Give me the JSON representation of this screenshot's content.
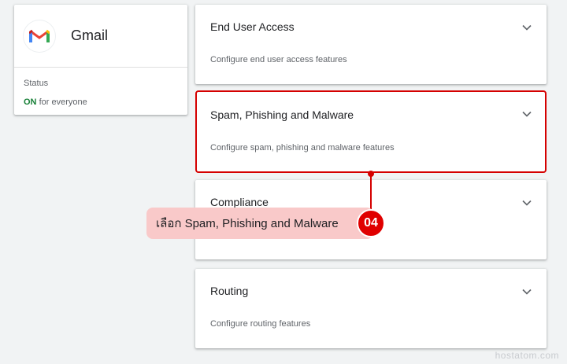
{
  "app": {
    "name": "Gmail",
    "status_label": "Status",
    "status_on": "ON",
    "status_scope": "for everyone"
  },
  "settings": [
    {
      "title": "End User Access",
      "description": "Configure end user access features"
    },
    {
      "title": "Spam, Phishing and Malware",
      "description": "Configure spam, phishing and malware features"
    },
    {
      "title": "Compliance",
      "description": ""
    },
    {
      "title": "Routing",
      "description": "Configure routing features"
    }
  ],
  "callout": {
    "text": "เลือก Spam, Phishing and Malware",
    "step": "04"
  },
  "watermark": "hostatom.com",
  "colors": {
    "highlight": "#d50000",
    "status_on": "#188038",
    "callout_bg": "#f9c9c9"
  }
}
